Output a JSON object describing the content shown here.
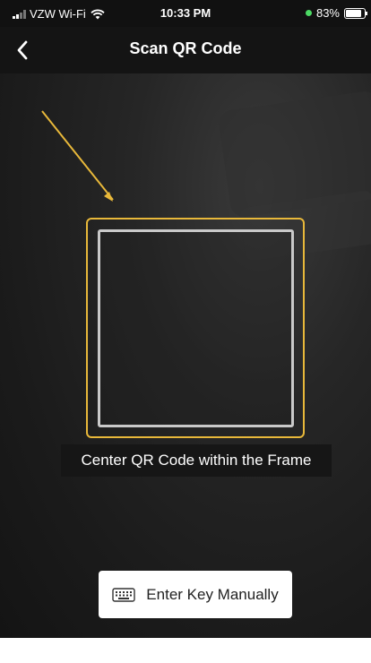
{
  "status_bar": {
    "carrier": "VZW Wi-Fi",
    "time": "10:33 PM",
    "battery_percent": "83%",
    "battery_level": 0.83,
    "icons": [
      "signal-icon",
      "wifi-icon",
      "charging-dot-icon",
      "battery-icon"
    ]
  },
  "nav": {
    "back_icon": "chevron-left-icon",
    "title": "Scan QR Code"
  },
  "scanner": {
    "hint": "Center QR Code within the Frame",
    "frame_color": "#e8b83a",
    "arrow_color": "#e8b83a"
  },
  "actions": {
    "manual_label": "Enter Key Manually",
    "manual_icon": "keyboard-icon"
  }
}
